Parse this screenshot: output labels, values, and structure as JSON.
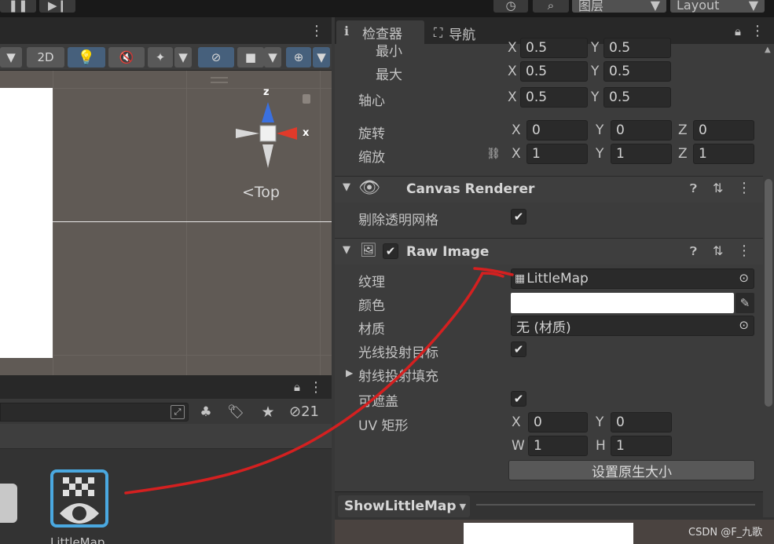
{
  "top_toolbar": {
    "layers_label": "图层",
    "layout_label": "Layout"
  },
  "scene": {
    "btn_2d": "2D",
    "gizmo": {
      "z_label": "z",
      "x_label": "x",
      "view_label": "Top"
    }
  },
  "project": {
    "search_value": "",
    "hidden_count": "21",
    "asset_label": "LittleMap"
  },
  "inspector": {
    "tabs": [
      {
        "label": "检查器"
      },
      {
        "label": "导航"
      }
    ],
    "rect": {
      "min_label": "最小",
      "min_x": "0.5",
      "min_y": "0.5",
      "max_label": "最大",
      "max_x": "0.5",
      "max_y": "0.5",
      "pivot_label": "轴心",
      "pivot_x": "0.5",
      "pivot_y": "0.5",
      "rotation_label": "旋转",
      "rot_x": "0",
      "rot_y": "0",
      "rot_z": "0",
      "scale_label": "缩放",
      "scale_x": "1",
      "scale_y": "1",
      "scale_z": "1",
      "axis_x": "X",
      "axis_y": "Y",
      "axis_z": "Z",
      "axis_w": "W",
      "axis_h": "H"
    },
    "canvas_renderer": {
      "title": "Canvas Renderer",
      "cull_label": "剔除透明网格"
    },
    "raw_image": {
      "title": "Raw Image",
      "texture_label": "纹理",
      "texture_value": "LittleMap",
      "color_label": "颜色",
      "color_value": "#ffffff",
      "material_label": "材质",
      "material_value": "无 (材质)",
      "raycast_target_label": "光线投射目标",
      "raycast_padding_label": "射线投射填充",
      "maskable_label": "可遮盖",
      "uv_label": "UV 矩形",
      "uv_x": "0",
      "uv_y": "0",
      "uv_w": "1",
      "uv_h": "1",
      "native_size_button": "设置原生大小"
    },
    "preview": {
      "object_name": "ShowLittleMap"
    },
    "watermark": "CSDN @F_九歌"
  },
  "colors": {
    "annotation_arrow": "#d42020",
    "gizmo_blue": "#3a70e0",
    "gizmo_red": "#e03a2a"
  }
}
